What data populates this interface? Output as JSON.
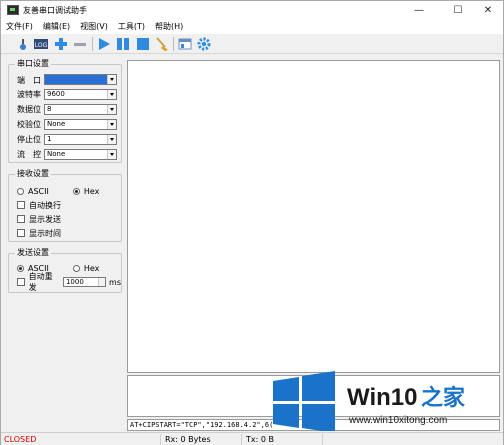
{
  "window": {
    "title": "友善串口调试助手",
    "minimize": "—",
    "maximize": "☐",
    "close": "✕"
  },
  "menu": [
    "文件(F)",
    "编辑(E)",
    "视图(V)",
    "工具(T)",
    "帮助(H)"
  ],
  "toolbar": {
    "items": [
      "new-icon",
      "log-icon",
      "add-icon",
      "remove-icon",
      "play-icon",
      "pause-icon",
      "stop-icon",
      "clear-icon",
      "layout-icon",
      "gear-icon"
    ],
    "log_text": "LOG"
  },
  "serial_settings": {
    "title": "串口设置",
    "port_label": "端　口",
    "port_value": "",
    "baud_label": "波特率",
    "baud_value": "9600",
    "databits_label": "数据位",
    "databits_value": "8",
    "parity_label": "校验位",
    "parity_value": "None",
    "stopbits_label": "停止位",
    "stopbits_value": "1",
    "flow_label": "流　控",
    "flow_value": "None"
  },
  "receive_settings": {
    "title": "接收设置",
    "ascii_label": "ASCII",
    "hex_label": "Hex",
    "selected": "Hex",
    "auto_newline": "自动换行",
    "show_send": "显示发送",
    "show_time": "显示时间"
  },
  "send_settings": {
    "title": "发送设置",
    "ascii_label": "ASCII",
    "hex_label": "Hex",
    "selected": "ASCII",
    "auto_repeat": "自动重发",
    "interval_value": "1000",
    "interval_unit": "ms"
  },
  "command_input": "AT+CIPSTART=\"TCP\",\"192.168.4.2\",6(",
  "status": {
    "state": "CLOSED",
    "rx": "Rx: 0 Bytes",
    "tx": "Tx: 0 B"
  },
  "watermark": {
    "brand": "Win10",
    "suffix": "之家",
    "url": "www.win10xitong.com"
  },
  "colors": {
    "closed": "#d40000",
    "accent_blue": "#2a6fd6",
    "watermark_blue": "#1a73c9"
  }
}
